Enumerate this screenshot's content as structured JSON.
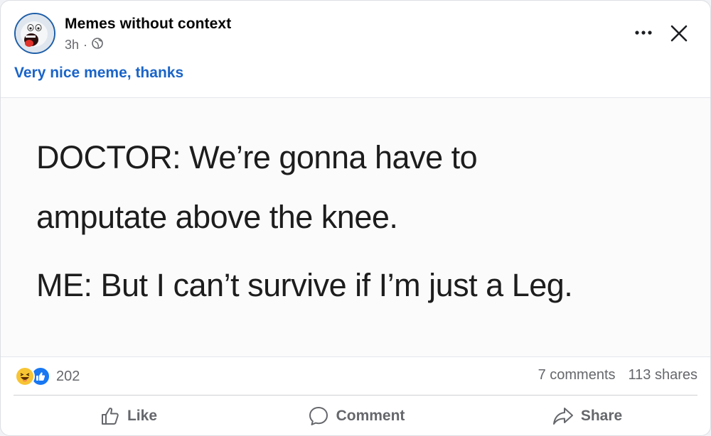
{
  "post": {
    "page_name": "Memes without context",
    "time": "3h",
    "separator": "·",
    "audience_icon": "globe-icon",
    "caption": "Very nice meme, thanks"
  },
  "header_actions": {
    "more_icon": "more-options-icon",
    "close_icon": "close-icon"
  },
  "meme": {
    "lines": [
      "DOCTOR: We’re gonna have to",
      "amputate above the knee.",
      "ME: But I can’t survive if I’m just a Leg."
    ]
  },
  "stats": {
    "reaction_icons": [
      "haha-reaction-icon",
      "like-reaction-icon"
    ],
    "reaction_count": "202",
    "comments": "7 comments",
    "shares": "113 shares"
  },
  "actions": {
    "like": "Like",
    "comment": "Comment",
    "share": "Share"
  },
  "colors": {
    "link_blue": "#1a64c8",
    "secondary_text": "#65676b",
    "like_blue": "#1877f2",
    "haha_yellow": "#f7c434"
  }
}
